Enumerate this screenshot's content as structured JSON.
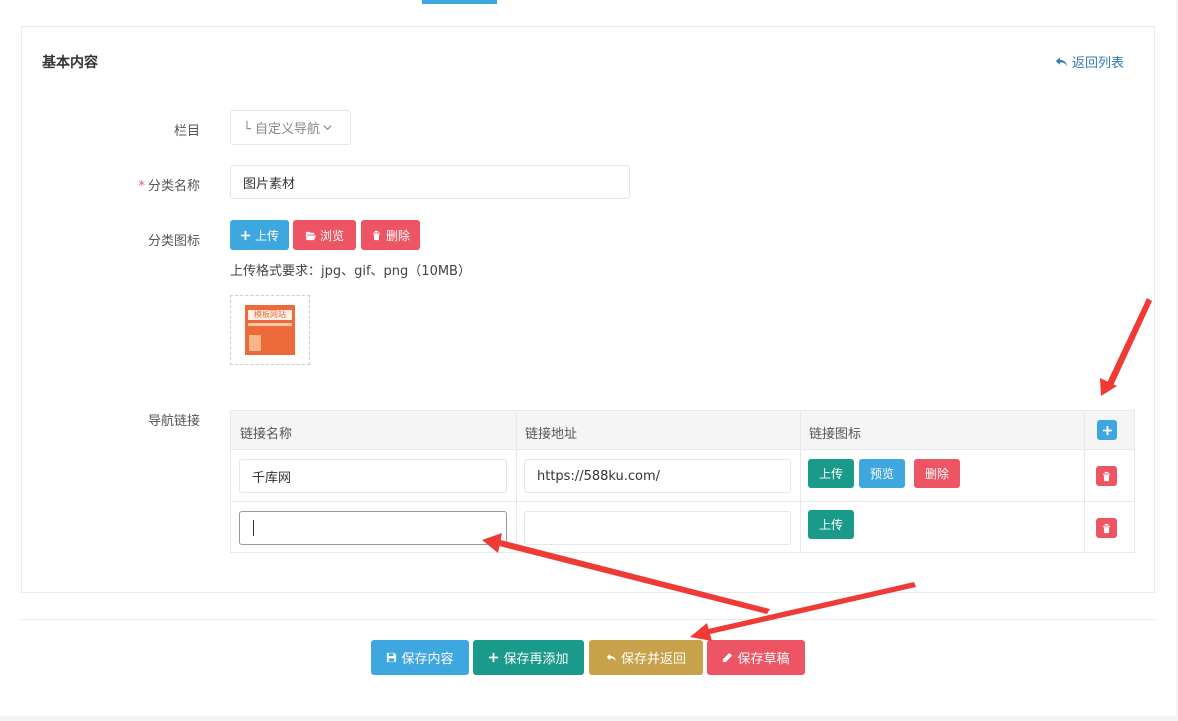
{
  "header": {
    "title": "基本内容",
    "back_label": "返回列表"
  },
  "form": {
    "column_label": "栏目",
    "column_value": "└ 自定义导航",
    "category_name_label": "分类名称",
    "category_name_value": "图片素材",
    "category_icon_label": "分类图标",
    "upload_label": "上传",
    "browse_label": "浏览",
    "delete_label": "删除",
    "upload_hint": "上传格式要求：jpg、gif、png（10MB）",
    "nav_links_label": "导航链接",
    "thumb_text": "模板网站"
  },
  "link_table": {
    "columns": [
      "链接名称",
      "链接地址",
      "链接图标"
    ],
    "rows": [
      {
        "name": "千库网",
        "url": "https://588ku.com/",
        "upload": "上传",
        "preview": "预览",
        "delete": "删除"
      },
      {
        "name": "",
        "url": "",
        "upload": "上传"
      }
    ]
  },
  "footer": {
    "save_label": "保存内容",
    "save_add_label": "保存再添加",
    "save_return_label": "保存并返回",
    "save_draft_label": "保存草稿"
  },
  "colors": {
    "blue": "#3ea7e0",
    "red": "#ed5565",
    "teal": "#1a9a8a",
    "gold": "#c8a24a",
    "annotation_arrow": "#ef3b36"
  }
}
